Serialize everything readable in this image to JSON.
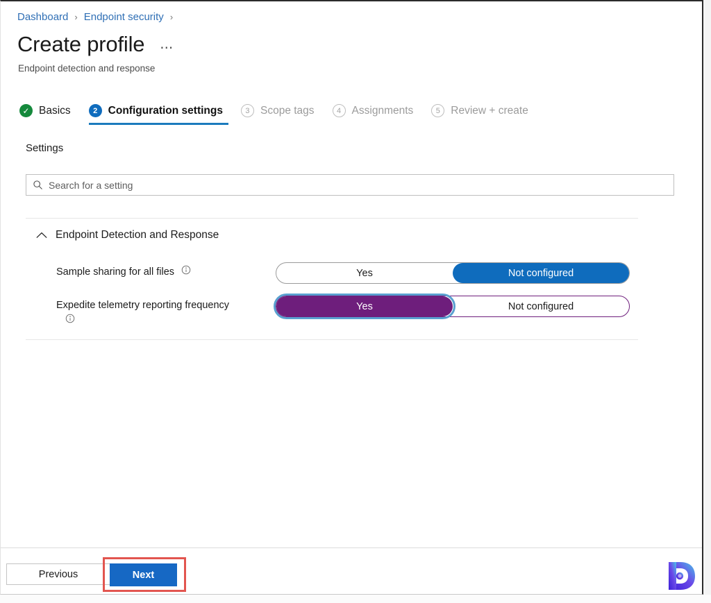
{
  "breadcrumb": {
    "items": [
      {
        "label": "Dashboard"
      },
      {
        "label": "Endpoint security"
      }
    ],
    "separator": "›"
  },
  "header": {
    "title": "Create profile",
    "subtitle": "Endpoint detection and response",
    "more_label": "⋯",
    "more_name": "more-options"
  },
  "wizard": {
    "tabs": [
      {
        "badge": "✓",
        "label": "Basics",
        "state": "done"
      },
      {
        "badge": "2",
        "label": "Configuration settings",
        "state": "active"
      },
      {
        "badge": "3",
        "label": "Scope tags",
        "state": "pending"
      },
      {
        "badge": "4",
        "label": "Assignments",
        "state": "pending"
      },
      {
        "badge": "5",
        "label": "Review + create",
        "state": "pending"
      }
    ]
  },
  "main": {
    "settings_heading": "Settings",
    "search": {
      "placeholder": "Search for a setting",
      "value": "",
      "icon": "search-icon"
    },
    "group": {
      "title": "Endpoint Detection and Response",
      "expanded": true,
      "chevron_icon": "chevron-up-icon"
    },
    "settings": [
      {
        "label": "Sample sharing for all files",
        "info_icon": "info-icon",
        "options": [
          "Yes",
          "Not configured"
        ],
        "selected": "Not configured",
        "selected_color": "#0f6cbd",
        "focused": false
      },
      {
        "label": "Expedite telemetry reporting frequency",
        "info_icon": "info-icon",
        "options": [
          "Yes",
          "Not configured"
        ],
        "selected": "Yes",
        "selected_color": "#6e1e7c",
        "focused": true
      }
    ]
  },
  "footer": {
    "previous_label": "Previous",
    "next_label": "Next",
    "highlight_color": "#e2554f"
  },
  "branding": {
    "logo_letter": "P",
    "logo_name": "prajwal-desai-logo"
  }
}
